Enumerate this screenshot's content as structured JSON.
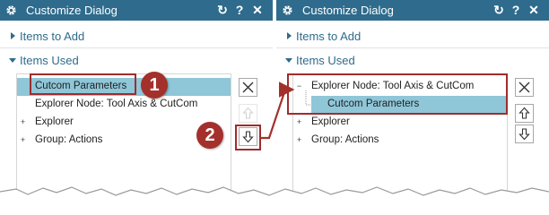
{
  "left_panel": {
    "title": "Customize Dialog",
    "controls": {
      "reset": "↻",
      "help": "?",
      "close": "✕"
    },
    "sections": {
      "add": "Items to Add",
      "used": "Items Used"
    },
    "tree": [
      {
        "label": "Cutcom Parameters",
        "selected": true
      },
      {
        "label": "Explorer Node: Tool Axis & CutCom",
        "selected": false
      },
      {
        "label": "Explorer",
        "expander": "+",
        "selected": false
      },
      {
        "label": "Group: Actions",
        "expander": "+",
        "selected": false
      }
    ]
  },
  "right_panel": {
    "title": "Customize Dialog",
    "controls": {
      "reset": "↻",
      "help": "?",
      "close": "✕"
    },
    "sections": {
      "add": "Items to Add",
      "used": "Items Used"
    },
    "tree": [
      {
        "label": "Explorer Node: Tool Axis & CutCom",
        "expander": "−",
        "selected": false
      },
      {
        "label": "Cutcom Parameters",
        "selected": true
      },
      {
        "label": "Explorer",
        "expander": "+",
        "selected": false
      },
      {
        "label": "Group: Actions",
        "expander": "+",
        "selected": false
      }
    ]
  },
  "callouts": {
    "step1": "1",
    "step2": "2"
  },
  "icons": {
    "settings": "gear-icon",
    "expand": "triangle-right-icon",
    "collapse": "triangle-down-icon",
    "remove": "x-icon",
    "move_up": "arrow-up-icon",
    "move_down": "arrow-down-icon"
  },
  "colors": {
    "titlebar": "#2e6b8c",
    "section_label": "#2e6b8c",
    "selection": "#8fc6d8",
    "callout": "#a3302b"
  }
}
